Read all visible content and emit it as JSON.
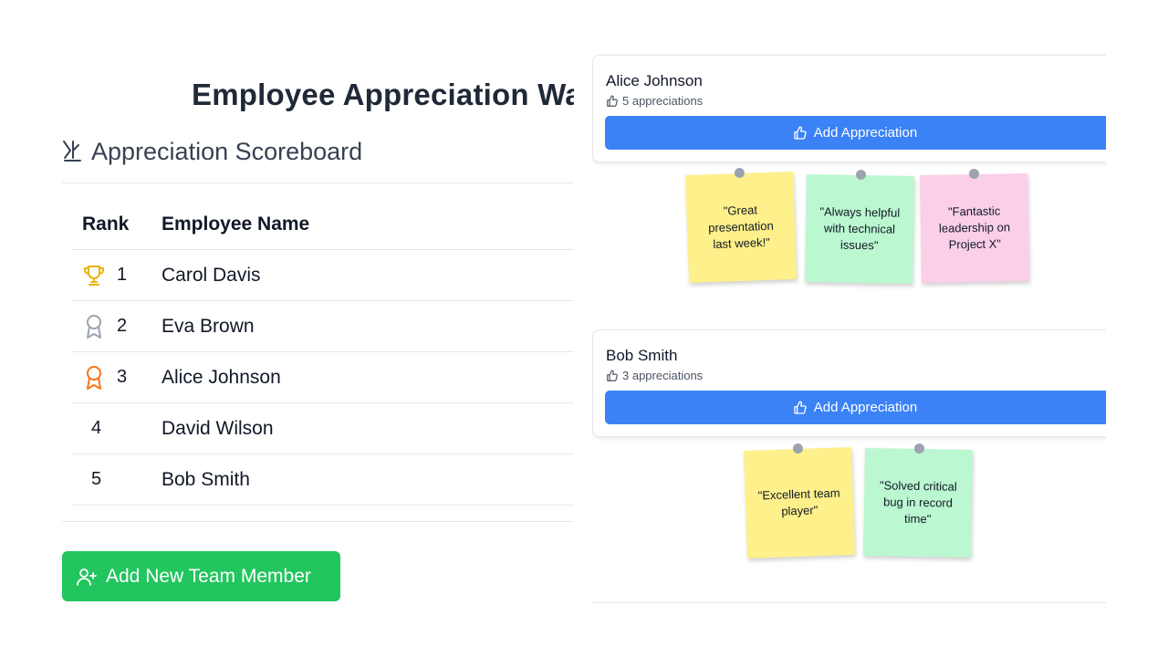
{
  "page": {
    "title": "Employee Appreciation Wa"
  },
  "scoreboard": {
    "title": "Appreciation Scoreboard",
    "columns": {
      "rank": "Rank",
      "name": "Employee Name"
    },
    "rows": [
      {
        "rank": "1",
        "name": "Carol Davis",
        "icon": "trophy-icon",
        "icon_color": "#eab308"
      },
      {
        "rank": "2",
        "name": "Eva Brown",
        "icon": "medal-icon",
        "icon_color": "#9ca3af"
      },
      {
        "rank": "3",
        "name": "Alice Johnson",
        "icon": "award-icon",
        "icon_color": "#f97316"
      },
      {
        "rank": "4",
        "name": "David Wilson"
      },
      {
        "rank": "5",
        "name": "Bob Smith"
      }
    ]
  },
  "add_member_label": "Add New Team Member",
  "employees": [
    {
      "name": "Alice Johnson",
      "count": "5 appreciations",
      "button_label": "Add Appreciation",
      "notes": [
        {
          "text": "\"Great presentation last week!\"",
          "color": "yellow"
        },
        {
          "text": "\"Always helpful with technical issues\"",
          "color": "green"
        },
        {
          "text": "\"Fantastic leadership on Project X\"",
          "color": "pink"
        }
      ]
    },
    {
      "name": "Bob Smith",
      "count": "3 appreciations",
      "button_label": "Add Appreciation",
      "notes": [
        {
          "text": "\"Excellent team player\"",
          "color": "yellow"
        },
        {
          "text": "\"Solved critical bug in record time\"",
          "color": "green"
        }
      ]
    }
  ],
  "colors": {
    "primary": "#3b82f6",
    "success": "#22c55e",
    "note_yellow": "#fef08a",
    "note_green": "#bbf7d0",
    "note_pink": "#fbcfe8"
  }
}
